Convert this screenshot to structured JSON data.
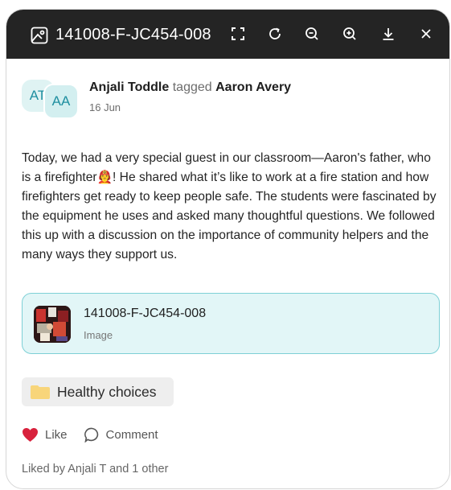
{
  "titlebar": {
    "title": "141008-F-JC454-008",
    "icons": [
      "image-icon",
      "expand-icon",
      "rotate-icon",
      "zoom-out-icon",
      "zoom-in-icon",
      "download-icon",
      "close-icon"
    ]
  },
  "post": {
    "avatars": [
      "AT",
      "AA"
    ],
    "author": "Anjali Toddle",
    "tagged_word": "tagged",
    "tagged_person": "Aaron Avery",
    "date": "16 Jun",
    "body": "Today, we had a very special guest in our classroom—Aaron's father, who is a firefighter🧑‍🚒! He shared what it’s like to work at a fire station and how firefighters get ready to keep people safe. The students were fascinated by the equipment he uses and asked many thoughtful questions. We followed this up with a discussion on the importance of community helpers and the many ways they support us."
  },
  "attachment": {
    "name": "141008-F-JC454-008",
    "type": "Image"
  },
  "tag": {
    "label": "Healthy choices",
    "icon": "folder-icon"
  },
  "actions": {
    "like": "Like",
    "comment": "Comment"
  },
  "liked_by": "Liked by Anjali T and 1 other",
  "colors": {
    "titlebar": "#242424",
    "accent": "#1f8fa0",
    "attachment_bg": "#e2f6f7",
    "attachment_border": "#7ed0d6",
    "like_heart": "#d8213c",
    "folder": "#f8d57a"
  }
}
